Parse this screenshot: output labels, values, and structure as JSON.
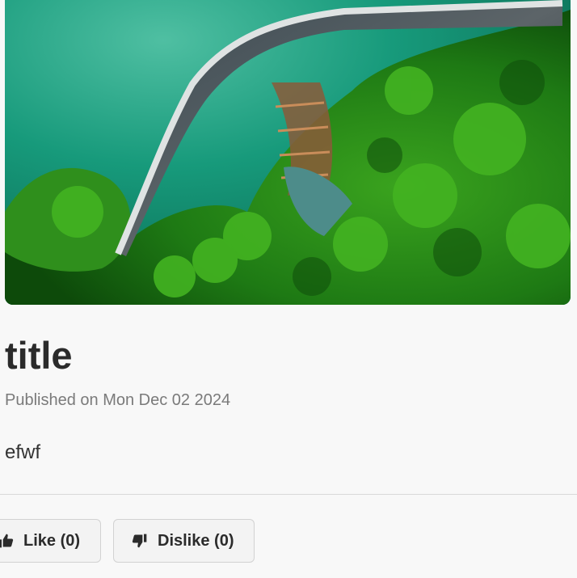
{
  "post": {
    "title": "title",
    "meta": "Published on Mon Dec 02 2024",
    "body": "efwf"
  },
  "hero_image": {
    "subject": "aerial view of a dam between a green reservoir and forest"
  },
  "actions": {
    "like_label": "Like (0)",
    "dislike_label": "Dislike (0)",
    "like_icon": "thumbs-up-icon",
    "dislike_icon": "thumbs-down-icon"
  },
  "colors": {
    "background": "#f8f8f8",
    "text": "#2b2b2b",
    "muted": "#7a7a7a",
    "button_bg": "#f3f3f3",
    "button_border": "#d2d2d2"
  }
}
